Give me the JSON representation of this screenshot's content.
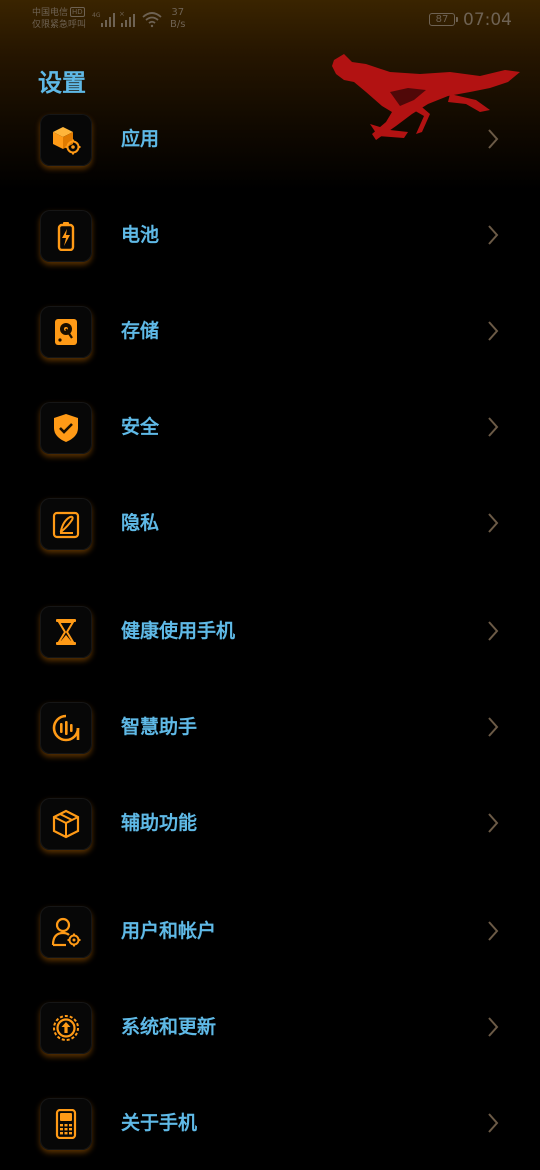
{
  "status_bar": {
    "carrier_line1": "中国电信",
    "hd_badge": "HD",
    "carrier_line2": "仅限紧急呼叫",
    "signal_tag": "4G",
    "speed_value": "37",
    "speed_unit": "B/s",
    "battery": "87",
    "time": "07:04"
  },
  "header": {
    "title": "设置"
  },
  "colors": {
    "accent_text": "#5fb9e6",
    "icon_orange": "#ff9a16",
    "logo_red": "#b21212",
    "chevron": "#6b5a46"
  },
  "settings": {
    "items": [
      {
        "label": "应用",
        "icon": "apps-icon"
      },
      {
        "label": "电池",
        "icon": "battery-icon"
      },
      {
        "label": "存储",
        "icon": "storage-icon"
      },
      {
        "label": "安全",
        "icon": "shield-icon"
      },
      {
        "label": "隐私",
        "icon": "privacy-icon"
      },
      {
        "label": "健康使用手机",
        "icon": "hourglass-icon"
      },
      {
        "label": "智慧助手",
        "icon": "assistant-icon"
      },
      {
        "label": "辅助功能",
        "icon": "accessibility-box-icon"
      },
      {
        "label": "用户和帐户",
        "icon": "user-gear-icon"
      },
      {
        "label": "系统和更新",
        "icon": "system-update-icon"
      },
      {
        "label": "关于手机",
        "icon": "phone-icon"
      }
    ]
  }
}
